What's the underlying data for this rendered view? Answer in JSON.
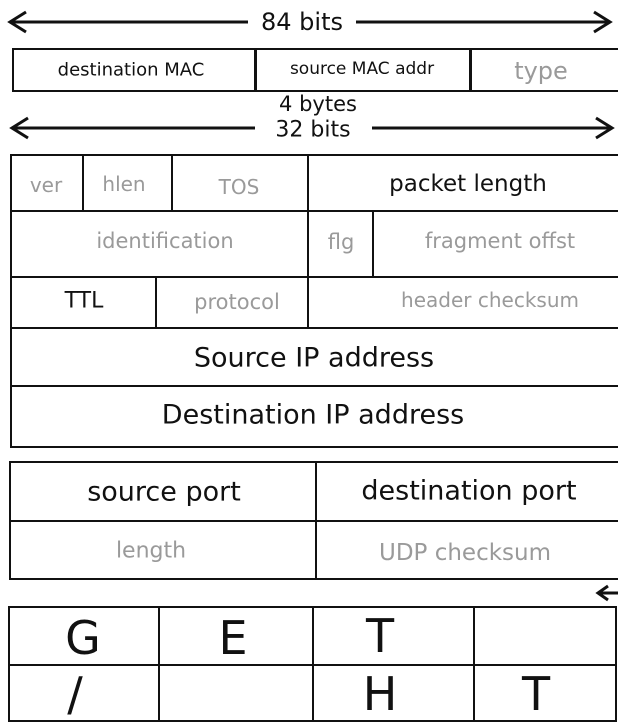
{
  "ethernet": {
    "width_label": "84 bits",
    "fields": {
      "dst": "destination MAC",
      "src": "source MAC addr",
      "type": "type"
    }
  },
  "ip": {
    "bytes_label": "4 bytes",
    "width_label": "32 bits",
    "row1": {
      "ver": "ver",
      "hlen": "hlen",
      "tos": "TOS",
      "len": "packet length"
    },
    "row2": {
      "id": "identification",
      "flg": "flg",
      "frag": "fragment offst"
    },
    "row3": {
      "ttl": "TTL",
      "proto": "protocol",
      "chk": "header checksum"
    },
    "row4": {
      "src": "Source IP address"
    },
    "row5": {
      "dst": "Destination IP address"
    }
  },
  "udp": {
    "row1": {
      "sport": "source port",
      "dport": "destination port"
    },
    "row2": {
      "len": "length",
      "chk": "UDP checksum"
    }
  },
  "payload": {
    "row1": [
      "G",
      "E",
      "T",
      ""
    ],
    "row2": [
      "/",
      "",
      "H",
      "T"
    ]
  }
}
